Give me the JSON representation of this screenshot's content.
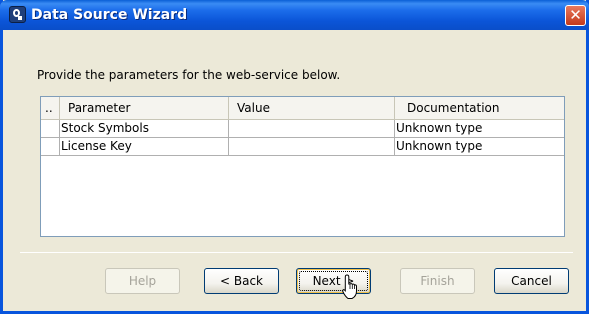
{
  "window": {
    "title": "Data Source Wizard",
    "app_icon": "wizard-app-icon",
    "close_glyph": "✕"
  },
  "instruction": "Provide the parameters for the web-service below.",
  "table": {
    "columns": {
      "index": "..",
      "parameter": "Parameter",
      "value": "Value",
      "documentation": "Documentation"
    },
    "rows": [
      {
        "index": "",
        "parameter": "Stock Symbols",
        "value": "",
        "documentation": "Unknown type"
      },
      {
        "index": "",
        "parameter": "License Key",
        "value": "",
        "documentation": "Unknown type"
      }
    ]
  },
  "buttons": {
    "help": "Help",
    "back": "< Back",
    "next": "Next >",
    "finish": "Finish",
    "cancel": "Cancel"
  },
  "colors": {
    "titlebar": "#0a4ec9",
    "window_bg": "#ece9d8",
    "close": "#c4391b"
  }
}
